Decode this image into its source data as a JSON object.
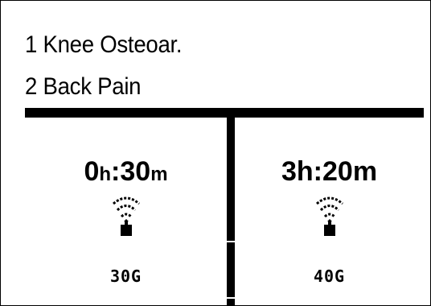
{
  "programs": [
    {
      "label": "1 Knee Osteoar."
    },
    {
      "label": "2 Back Pain"
    }
  ],
  "channels": [
    {
      "timer_h": "0",
      "timer_h_unit": "h",
      "timer_sep": ":",
      "timer_m": "30",
      "timer_m_unit": "m",
      "signal_icon": "wireless-signal-icon",
      "intensity": "30G"
    },
    {
      "timer_h": "3",
      "timer_h_unit": "h",
      "timer_sep": ":",
      "timer_m": "20",
      "timer_m_unit": "m",
      "signal_icon": "wireless-signal-icon",
      "intensity": "40G"
    }
  ],
  "colors": {
    "foreground": "#000000",
    "background": "#ffffff"
  }
}
